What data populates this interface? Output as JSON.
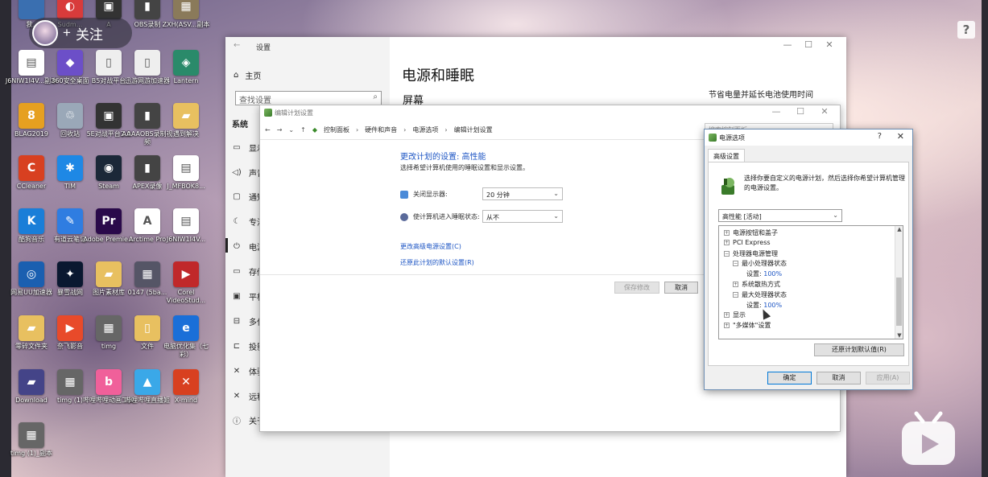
{
  "overlay": {
    "follow_label": "关注",
    "follow_plus": "+",
    "help_glyph": "?"
  },
  "desktop_icons": [
    {
      "label": "我..",
      "color": "#3a6fb0",
      "glyph": ""
    },
    {
      "label": "Sudm...",
      "color": "#d83b3b",
      "glyph": "◐"
    },
    {
      "label": "A",
      "color": "#333333",
      "glyph": "▣"
    },
    {
      "label": "OBS录制",
      "color": "#444444",
      "glyph": "▮"
    },
    {
      "label": "ZXH(ASV...副本",
      "color": "#8a7a5a",
      "glyph": "▦"
    },
    {
      "label": "J6NIW1I4V...副本",
      "color": "#ffffff",
      "glyph": "▤"
    },
    {
      "label": "360安全桌面",
      "color": "#6c4fc8",
      "glyph": "◆"
    },
    {
      "label": "B5对战平台",
      "color": "#eeeeee",
      "glyph": "▯"
    },
    {
      "label": "迅游网游加速器",
      "color": "#eeeeee",
      "glyph": "▯"
    },
    {
      "label": "Lantern",
      "color": "#2a8a6a",
      "glyph": "◈"
    },
    {
      "label": "BLAG2019",
      "color": "#e6a020",
      "glyph": "8"
    },
    {
      "label": "回收站",
      "color": "#9aa8b8",
      "glyph": "♲"
    },
    {
      "label": "5E对战平台2.0",
      "color": "#333333",
      "glyph": "▣"
    },
    {
      "label": "AAAAOBS录制视频",
      "color": "#444444",
      "glyph": "▮"
    },
    {
      "label": "遇到解决",
      "color": "#e8c060",
      "glyph": "▰"
    },
    {
      "label": "CCleaner",
      "color": "#d84020",
      "glyph": "C"
    },
    {
      "label": "TIM",
      "color": "#1e88e5",
      "glyph": "✱"
    },
    {
      "label": "Steam",
      "color": "#1b2838",
      "glyph": "◉"
    },
    {
      "label": "APEX录像",
      "color": "#444444",
      "glyph": "▮"
    },
    {
      "label": "J_MFBOK8...",
      "color": "#ffffff",
      "glyph": "▤"
    },
    {
      "label": "酷狗音乐",
      "color": "#1a7ed8",
      "glyph": "K"
    },
    {
      "label": "有道云笔记",
      "color": "#2f7de1",
      "glyph": "✎"
    },
    {
      "label": "Adobe Premie...",
      "color": "#2a0a4a",
      "glyph": "Pr"
    },
    {
      "label": "Arctime Pro",
      "color": "#ffffff",
      "glyph": "A"
    },
    {
      "label": "J6NIW1I4V...",
      "color": "#ffffff",
      "glyph": "▤"
    },
    {
      "label": "网易UU加速器",
      "color": "#1a5fb0",
      "glyph": "◎"
    },
    {
      "label": "暴雪战网",
      "color": "#0a1830",
      "glyph": "✦"
    },
    {
      "label": "图片素材库",
      "color": "#e8c060",
      "glyph": "▰"
    },
    {
      "label": "0147 (5ba...",
      "color": "#555566",
      "glyph": "▦"
    },
    {
      "label": "Corel VideoStud...",
      "color": "#c0282a",
      "glyph": "▶"
    },
    {
      "label": "零碎文件夹",
      "color": "#e8c060",
      "glyph": "▰"
    },
    {
      "label": "奈飞影音",
      "color": "#e84a2a",
      "glyph": "▶"
    },
    {
      "label": "timg",
      "color": "#666666",
      "glyph": "▦"
    },
    {
      "label": "文件",
      "color": "#e8c060",
      "glyph": "▯"
    },
    {
      "label": "电脑优化集（七彩）",
      "color": "#1a6fd8",
      "glyph": "e"
    },
    {
      "label": "Download",
      "color": "#444488",
      "glyph": "▰"
    },
    {
      "label": "timg (1)",
      "color": "#666666",
      "glyph": "▦"
    },
    {
      "label": "哔哩哔哩动画工具",
      "color": "#f0609a",
      "glyph": "b"
    },
    {
      "label": "哔哩哔哩直播姬",
      "color": "#3aa8e8",
      "glyph": "▲"
    },
    {
      "label": "X-mind",
      "color": "#d84020",
      "glyph": "✕"
    },
    {
      "label": "timg (1)_副本",
      "color": "#666666",
      "glyph": "▦"
    }
  ],
  "settings": {
    "window_title": "设置",
    "back_icon": "←",
    "controls": [
      "—",
      "☐",
      "✕"
    ],
    "home_label": "主页",
    "search_placeholder": "查找设置",
    "section_label": "系统",
    "nav_items": [
      {
        "label": "显示",
        "icon": "▭"
      },
      {
        "label": "声音",
        "icon": "◁)"
      },
      {
        "label": "通知",
        "icon": "▢"
      },
      {
        "label": "专注",
        "icon": "☾"
      },
      {
        "label": "电源",
        "icon": "⏻"
      },
      {
        "label": "存储",
        "icon": "▭"
      },
      {
        "label": "平板",
        "icon": "▣"
      },
      {
        "label": "多任",
        "icon": "⊟"
      },
      {
        "label": "投影",
        "icon": "⊏"
      },
      {
        "label": "体验",
        "icon": "✕"
      },
      {
        "label": "远程",
        "icon": "✕"
      },
      {
        "label": "关于",
        "icon": "ⓘ"
      }
    ],
    "page_heading": "电源和睡眠",
    "screen_heading": "屏幕",
    "right_tip": "节省电量并延长电池使用时间"
  },
  "edit_plan": {
    "window_title": "编辑计划设置",
    "controls": [
      "—",
      "☐",
      "✕"
    ],
    "address": {
      "nav": [
        "←",
        "→",
        "⌄",
        "↑"
      ],
      "crumbs": [
        "控制面板",
        "硬件和声音",
        "电源选项",
        "编辑计划设置"
      ]
    },
    "search_placeholder": "搜索控制面板",
    "heading": "更改计划的设置: 高性能",
    "subtitle": "选择希望计算机使用的睡眠设置和显示设置。",
    "display_label": "关闭显示器:",
    "display_value": "20 分钟",
    "sleep_label": "使计算机进入睡眠状态:",
    "sleep_value": "从不",
    "advanced_link": "更改高级电源设置(C)",
    "restore_link": "还原此计划的默认设置(R)",
    "save_button": "保存修改",
    "cancel_button": "取消"
  },
  "power_options": {
    "window_title": "电源选项",
    "help_glyph": "?",
    "close_glyph": "✕",
    "tab_label": "高级设置",
    "description": "选择你要自定义的电源计划，然后选择你希望计算机管理的电源设置。",
    "plan_value": "高性能 [活动]",
    "tree": [
      {
        "label": "电源按钮和盖子",
        "box": "+",
        "level": 0
      },
      {
        "label": "PCI Express",
        "box": "+",
        "level": 0
      },
      {
        "label": "处理器电源管理",
        "box": "−",
        "level": 0
      },
      {
        "label": "最小处理器状态",
        "box": "−",
        "level": 1
      },
      {
        "label": "设置:",
        "value": "100%",
        "level": 2
      },
      {
        "label": "系统散热方式",
        "box": "+",
        "level": 1
      },
      {
        "label": "最大处理器状态",
        "box": "−",
        "level": 1
      },
      {
        "label": "设置:",
        "value": "100%",
        "level": 2
      },
      {
        "label": "显示",
        "box": "+",
        "level": 0
      },
      {
        "label": "\"多媒体\"设置",
        "box": "+",
        "level": 0
      }
    ],
    "restore_button": "还原计划默认值(R)",
    "ok_button": "确定",
    "cancel_button": "取消",
    "apply_button": "应用(A)",
    "scroll_up": "▲",
    "scroll_down": "▼"
  }
}
